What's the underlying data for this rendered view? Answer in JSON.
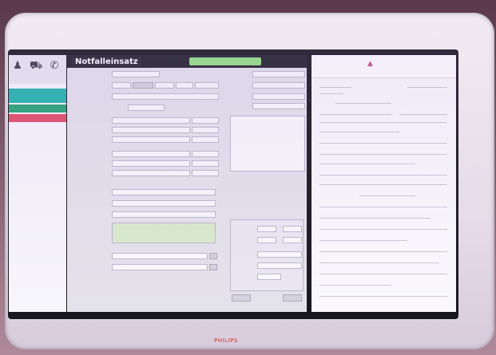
{
  "app": {
    "form_title": "Notfalleinsatz",
    "save_label": "",
    "brand": "PHILIPS"
  },
  "leftnav": {
    "icons": [
      "person-icon",
      "car-icon",
      "phone-icon"
    ]
  },
  "colors": {
    "status_teal": "#15b1a8",
    "status_green": "#17a06a",
    "status_red": "#e0445d",
    "save_green": "#8ee07c"
  }
}
